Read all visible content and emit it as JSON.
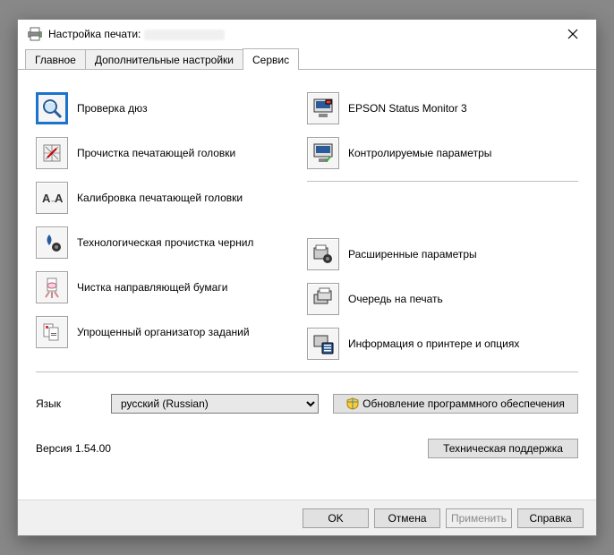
{
  "window": {
    "title_prefix": "Настройка печати:",
    "close_tooltip": "Закрыть"
  },
  "tabs": {
    "main": "Главное",
    "advanced": "Дополнительные настройки",
    "service": "Сервис"
  },
  "tools_left": {
    "nozzle_check": "Проверка дюз",
    "head_cleaning": "Прочистка печатающей головки",
    "head_alignment": "Калибровка печатающей головки",
    "power_ink_flush": "Технологическая прочистка чернил",
    "paper_guide_clean": "Чистка направляющей бумаги",
    "job_arranger": "Упрощенный организатор заданий"
  },
  "tools_right": {
    "status_monitor": "EPSON Status Monitor 3",
    "monitored_params": "Контролируемые параметры",
    "extended_settings": "Расширенные параметры",
    "print_queue": "Очередь на печать",
    "printer_info": "Информация о принтере и опциях"
  },
  "language": {
    "label": "Язык",
    "value": "русский (Russian)",
    "options": [
      "русский (Russian)"
    ]
  },
  "update_button": "Обновление программного обеспечения",
  "version": "Версия 1.54.00",
  "tech_support": "Техническая поддержка",
  "footer": {
    "ok": "OK",
    "cancel": "Отмена",
    "apply": "Применить",
    "help": "Справка"
  }
}
